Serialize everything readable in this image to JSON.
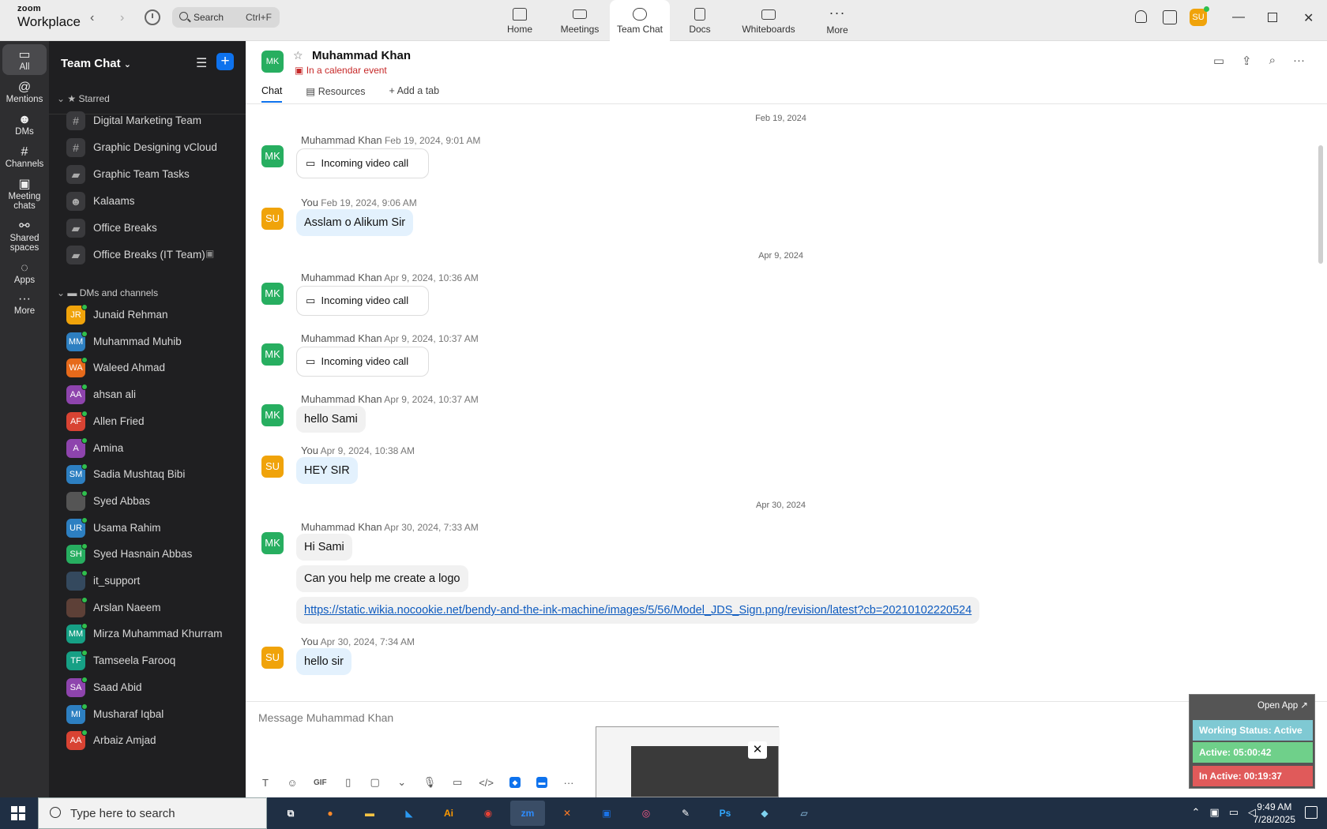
{
  "app": {
    "brand_line1": "zoom",
    "brand_line2": "Workplace"
  },
  "search": {
    "label": "Search",
    "shortcut": "Ctrl+F"
  },
  "top_tabs": [
    {
      "label": "Home"
    },
    {
      "label": "Meetings"
    },
    {
      "label": "Team Chat"
    },
    {
      "label": "Docs"
    },
    {
      "label": "Whiteboards"
    },
    {
      "label": "More"
    }
  ],
  "user": {
    "initials": "SU",
    "color": "#f0a30a"
  },
  "rail": [
    {
      "label": "All"
    },
    {
      "label": "Mentions"
    },
    {
      "label": "DMs"
    },
    {
      "label": "Channels"
    },
    {
      "label_line1": "Meeting",
      "label_line2": "chats"
    },
    {
      "label_line1": "Shared",
      "label_line2": "spaces"
    },
    {
      "label": "Apps"
    },
    {
      "label": "More"
    }
  ],
  "sidebar": {
    "title": "Team Chat",
    "starred_label": "Starred",
    "starred": [
      {
        "name": "Digital Marketing Team",
        "icon": "#"
      },
      {
        "name": "Graphic Designing vCloud",
        "icon": "#"
      },
      {
        "name": "Graphic Team Tasks",
        "icon": "lock"
      },
      {
        "name": "Kalaams",
        "icon": "group"
      },
      {
        "name": "Office Breaks",
        "icon": "lock"
      },
      {
        "name": "Office Breaks (IT Team)",
        "icon": "lock"
      }
    ],
    "dms_label": "DMs and channels",
    "dms": [
      {
        "initials": "JR",
        "name": "Junaid Rehman",
        "color": "#f0a30a"
      },
      {
        "initials": "MM",
        "name": "Muhammad Muhib",
        "color": "#2d7fc1"
      },
      {
        "initials": "WA",
        "name": "Waleed Ahmad",
        "color": "#e66a1b"
      },
      {
        "initials": "AA",
        "name": "ahsan ali",
        "color": "#8e44ad"
      },
      {
        "initials": "AF",
        "name": "Allen Fried",
        "color": "#d84333"
      },
      {
        "initials": "A",
        "name": "Amina",
        "color": "#8e44ad"
      },
      {
        "initials": "SM",
        "name": "Sadia Mushtaq Bibi",
        "color": "#2d7fc1"
      },
      {
        "initials": "",
        "name": "Syed Abbas",
        "color": "#555555"
      },
      {
        "initials": "UR",
        "name": "Usama Rahim",
        "color": "#2d7fc1"
      },
      {
        "initials": "SH",
        "name": "Syed Hasnain Abbas",
        "color": "#27ae60"
      },
      {
        "initials": "",
        "name": "it_support",
        "color": "#34495e"
      },
      {
        "initials": "",
        "name": "Arslan Naeem",
        "color": "#5d4037"
      },
      {
        "initials": "MM",
        "name": "Mirza Muhammad Khurram",
        "color": "#16a085"
      },
      {
        "initials": "TF",
        "name": "Tamseela Farooq",
        "color": "#16a085"
      },
      {
        "initials": "SA",
        "name": "Saad Abid",
        "color": "#8e44ad"
      },
      {
        "initials": "MI",
        "name": "Musharaf Iqbal",
        "color": "#2d7fc1"
      },
      {
        "initials": "AA",
        "name": "Arbaiz Amjad",
        "color": "#d84333"
      }
    ]
  },
  "chat": {
    "contact_initials": "MK",
    "contact_color": "#27ae60",
    "contact_name": "Muhammad Khan",
    "contact_status": "In a calendar event",
    "tabs": [
      "Chat",
      "Resources",
      "Add a tab"
    ],
    "dates": [
      "Feb 19, 2024",
      "Apr 9, 2024",
      "Apr 30, 2024"
    ],
    "messages": [
      {
        "sender": "Muhammad Khan",
        "time": "Feb 19, 2024, 9:01 AM",
        "text": "Incoming video call"
      },
      {
        "sender": "You",
        "time": "Feb 19, 2024, 9:06 AM",
        "text": "Asslam o Alikum Sir"
      },
      {
        "sender": "Muhammad Khan",
        "time": "Apr 9, 2024, 10:36 AM",
        "text": "Incoming video call"
      },
      {
        "sender": "Muhammad Khan",
        "time": "Apr 9, 2024, 10:37 AM",
        "text": "Incoming video call"
      },
      {
        "sender": "Muhammad Khan",
        "time": "Apr 9, 2024, 10:37 AM",
        "text": "hello Sami"
      },
      {
        "sender": "You",
        "time": "Apr 9, 2024, 10:38 AM",
        "text": "HEY SIR"
      },
      {
        "sender": "Muhammad Khan",
        "time": "Apr 30, 2024, 7:33 AM",
        "text": "Hi Sami",
        "text2": "Can you help me create a logo",
        "link": "https://static.wikia.nocookie.net/bendy-and-the-ink-machine/images/5/56/Model_JDS_Sign.png/revision/latest?cb=20210102220524"
      },
      {
        "sender": "You",
        "time": "Apr 30, 2024, 7:34 AM",
        "text": "hello sir"
      }
    ],
    "compose_placeholder": "Message Muhammad Khan"
  },
  "widget": {
    "open_label": "Open App ↗",
    "working": "Working Status: Active",
    "active": "Active: 05:00:42",
    "inactive": "In Active: 00:19:37",
    "colors": {
      "working": "#7fc9d3",
      "active": "#6fd08a",
      "inactive": "#e05a5a"
    }
  },
  "taskbar": {
    "search_placeholder": "Type here to search",
    "time": "9:49 AM",
    "date": "7/28/2025",
    "apps": [
      "firefox-icon",
      "explorer-icon",
      "vscode-icon",
      "Ai",
      "chrome-icon",
      "zm",
      "xampp-icon",
      "outlook-icon",
      "creative-cloud-icon",
      "pen-icon",
      "Ps",
      "diamond-icon",
      "notepad-icon"
    ]
  }
}
